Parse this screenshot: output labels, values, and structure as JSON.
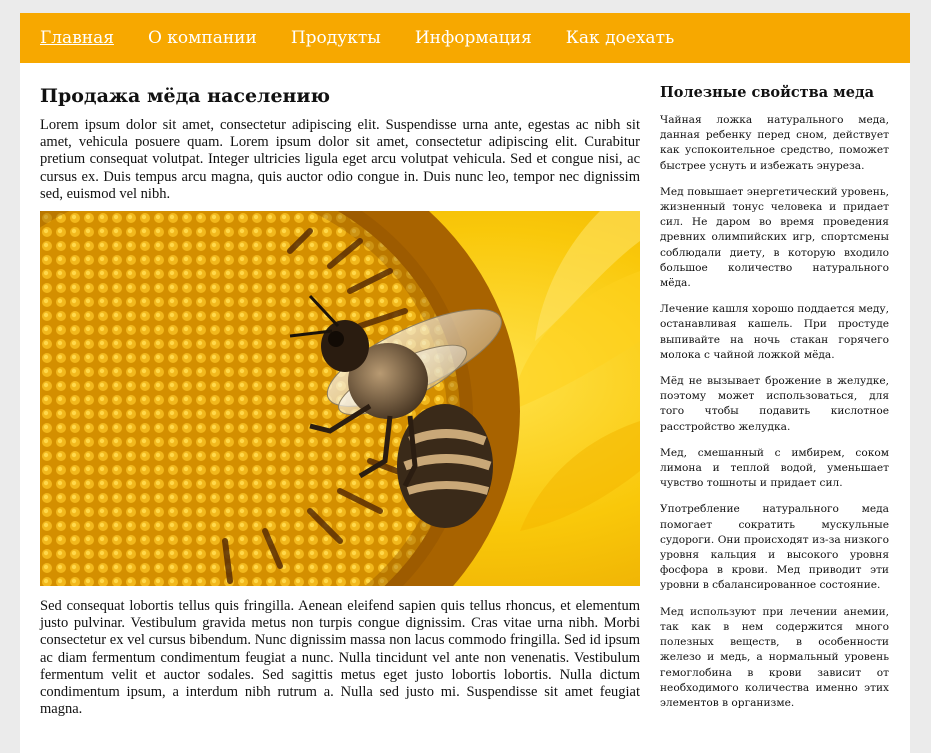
{
  "nav": {
    "items": [
      {
        "label": "Главная"
      },
      {
        "label": "О компании"
      },
      {
        "label": "Продукты"
      },
      {
        "label": "Информация"
      },
      {
        "label": "Как доехать"
      }
    ]
  },
  "main": {
    "title": "Продажа мёда населению",
    "intro": "Lorem ipsum dolor sit amet, consectetur adipiscing elit. Suspendisse urna ante, egestas ac nibh sit amet, vehicula posuere quam. Lorem ipsum dolor sit amet, consectetur adipiscing elit. Curabitur pretium consequat volutpat. Integer ultricies ligula eget arcu volutpat vehicula. Sed et congue nisi, ac cursus ex. Duis tempus arcu magna, quis auctor odio congue in. Duis nunc leo, tempor nec dignissim sed, euismod vel nibh.",
    "body": "Sed consequat lobortis tellus quis fringilla. Aenean eleifend sapien quis tellus rhoncus, et elementum justo pulvinar. Vestibulum gravida metus non turpis congue dignissim. Cras vitae urna nibh. Morbi consectetur ex vel cursus bibendum. Nunc dignissim massa non lacus commodo fringilla. Sed id ipsum ac diam fermentum condimentum feugiat a nunc. Nulla tincidunt vel ante non venenatis. Vestibulum fermentum velit et auctor sodales. Sed sagittis metus eget justo lobortis lobortis. Nulla dictum condimentum ipsum, a interdum nibh rutrum a. Nulla sed justo mi. Suspendisse sit amet feugiat magna."
  },
  "sidebar": {
    "title": "Полезные свойства меда",
    "paragraphs": [
      "Чайная ложка натурального меда, данная ребенку перед сном, действует как успокоительное средство, поможет быстрее уснуть и избежать энуреза.",
      "Мед повышает энергетический уровень, жизненный тонус человека и придает сил. Не даром во время проведения древних олимпийских игр, спортсмены соблюдали диету, в которую входило большое количество натурального мёда.",
      "Лечение кашля хорошо поддается меду, останавливая кашель. При простуде выпивайте на ночь стакан горячего молока с чайной ложкой мёда.",
      "Мёд не вызывает брожение в желудке, поэтому может использоваться, для того чтобы подавить кислотное расстройство желудка.",
      "Мед, смешанный с имбирем, соком лимона и теплой водой, уменьшает чувство тошноты и придает сил.",
      "Употребление натурального меда помогает сократить мускульные судороги. Они происходят из-за низкого уровня кальция и высокого уровня фосфора в крови. Мед приводит эти уровни в сбалансированное состояние.",
      "Мед используют при лечении анемии, так как в нем содержится много полезных веществ, в особенности железо и медь, а нормальный уровень гемоглобина в крови зависит от необходимого количества именно этих элементов в организме."
    ]
  },
  "colors": {
    "nav_bg": "#f7a800",
    "page_bg": "#ebebeb",
    "content_bg": "#ffffff"
  }
}
